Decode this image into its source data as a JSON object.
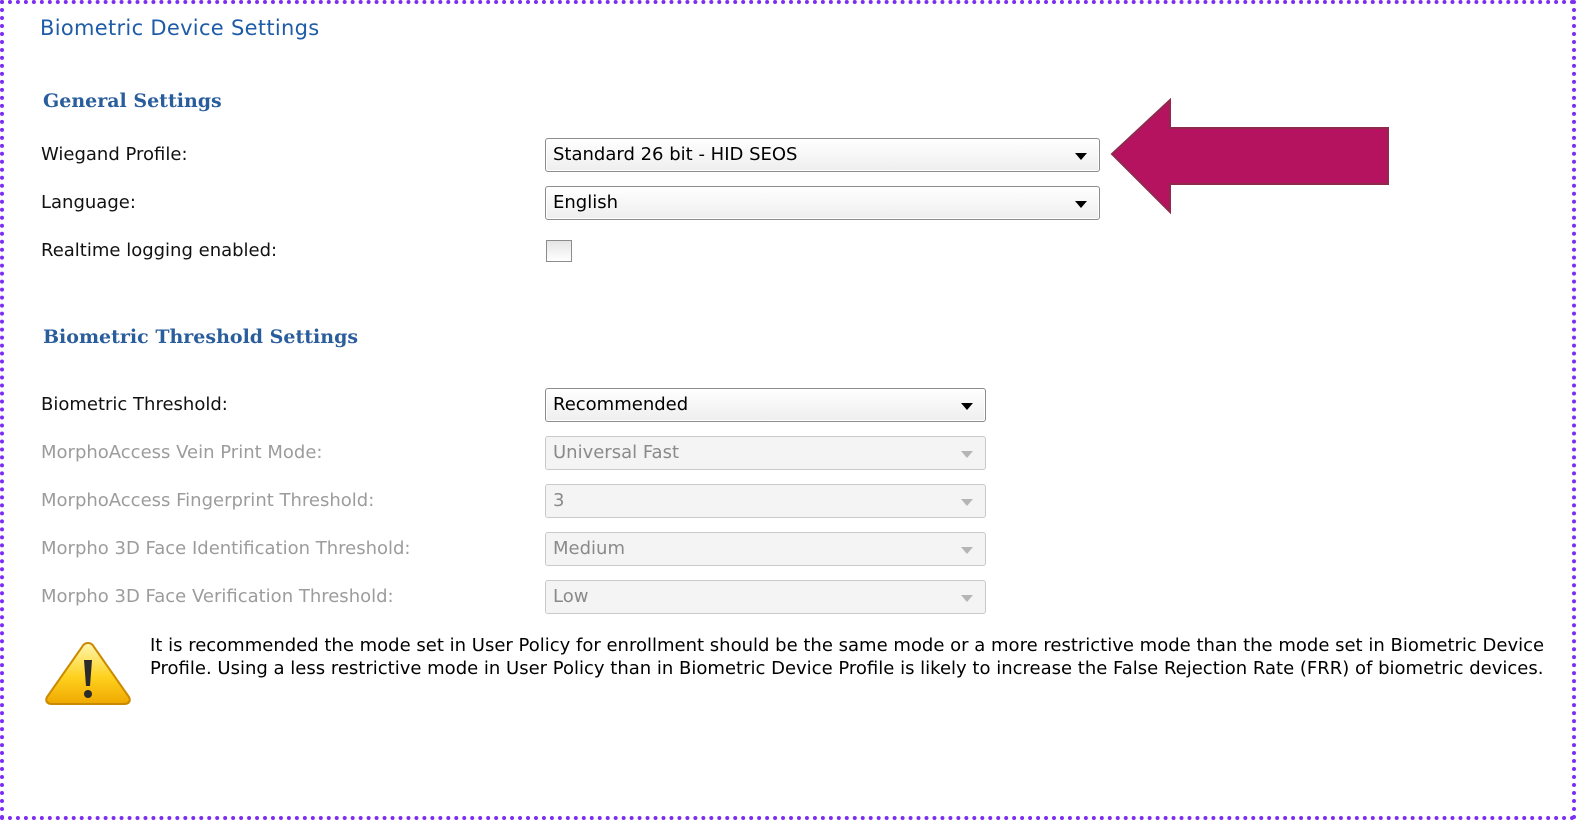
{
  "page": {
    "title": "Biometric Device Settings"
  },
  "general": {
    "title": "General Settings",
    "wiegand_label": "Wiegand Profile:",
    "wiegand_value": "Standard 26 bit - HID SEOS",
    "language_label": "Language:",
    "language_value": "English",
    "realtime_label": "Realtime logging enabled:",
    "realtime_checked": false
  },
  "threshold": {
    "title": "Biometric Threshold Settings",
    "biometric_label": "Biometric Threshold:",
    "biometric_value": "Recommended",
    "vein_label": "MorphoAccess Vein Print Mode:",
    "vein_value": "Universal Fast",
    "fingerprint_label": "MorphoAccess Fingerprint Threshold:",
    "fingerprint_value": "3",
    "face_id_label": "Morpho 3D Face Identification Threshold:",
    "face_id_value": "Medium",
    "face_verif_label": "Morpho 3D Face Verification Threshold:",
    "face_verif_value": "Low"
  },
  "warning": {
    "icon": "warning-icon",
    "text": "It is recommended the mode set in User Policy for enrollment should be the same mode or a more restrictive mode than the mode set in Biometric Device Profile.  Using a less restrictive mode in User Policy than in Biometric Device Profile is likely to increase the False Rejection Rate (FRR) of biometric devices."
  },
  "colors": {
    "frame_border": "#7c2ff0",
    "heading": "#1f5ca8",
    "annotation_arrow": "#b5135f"
  }
}
